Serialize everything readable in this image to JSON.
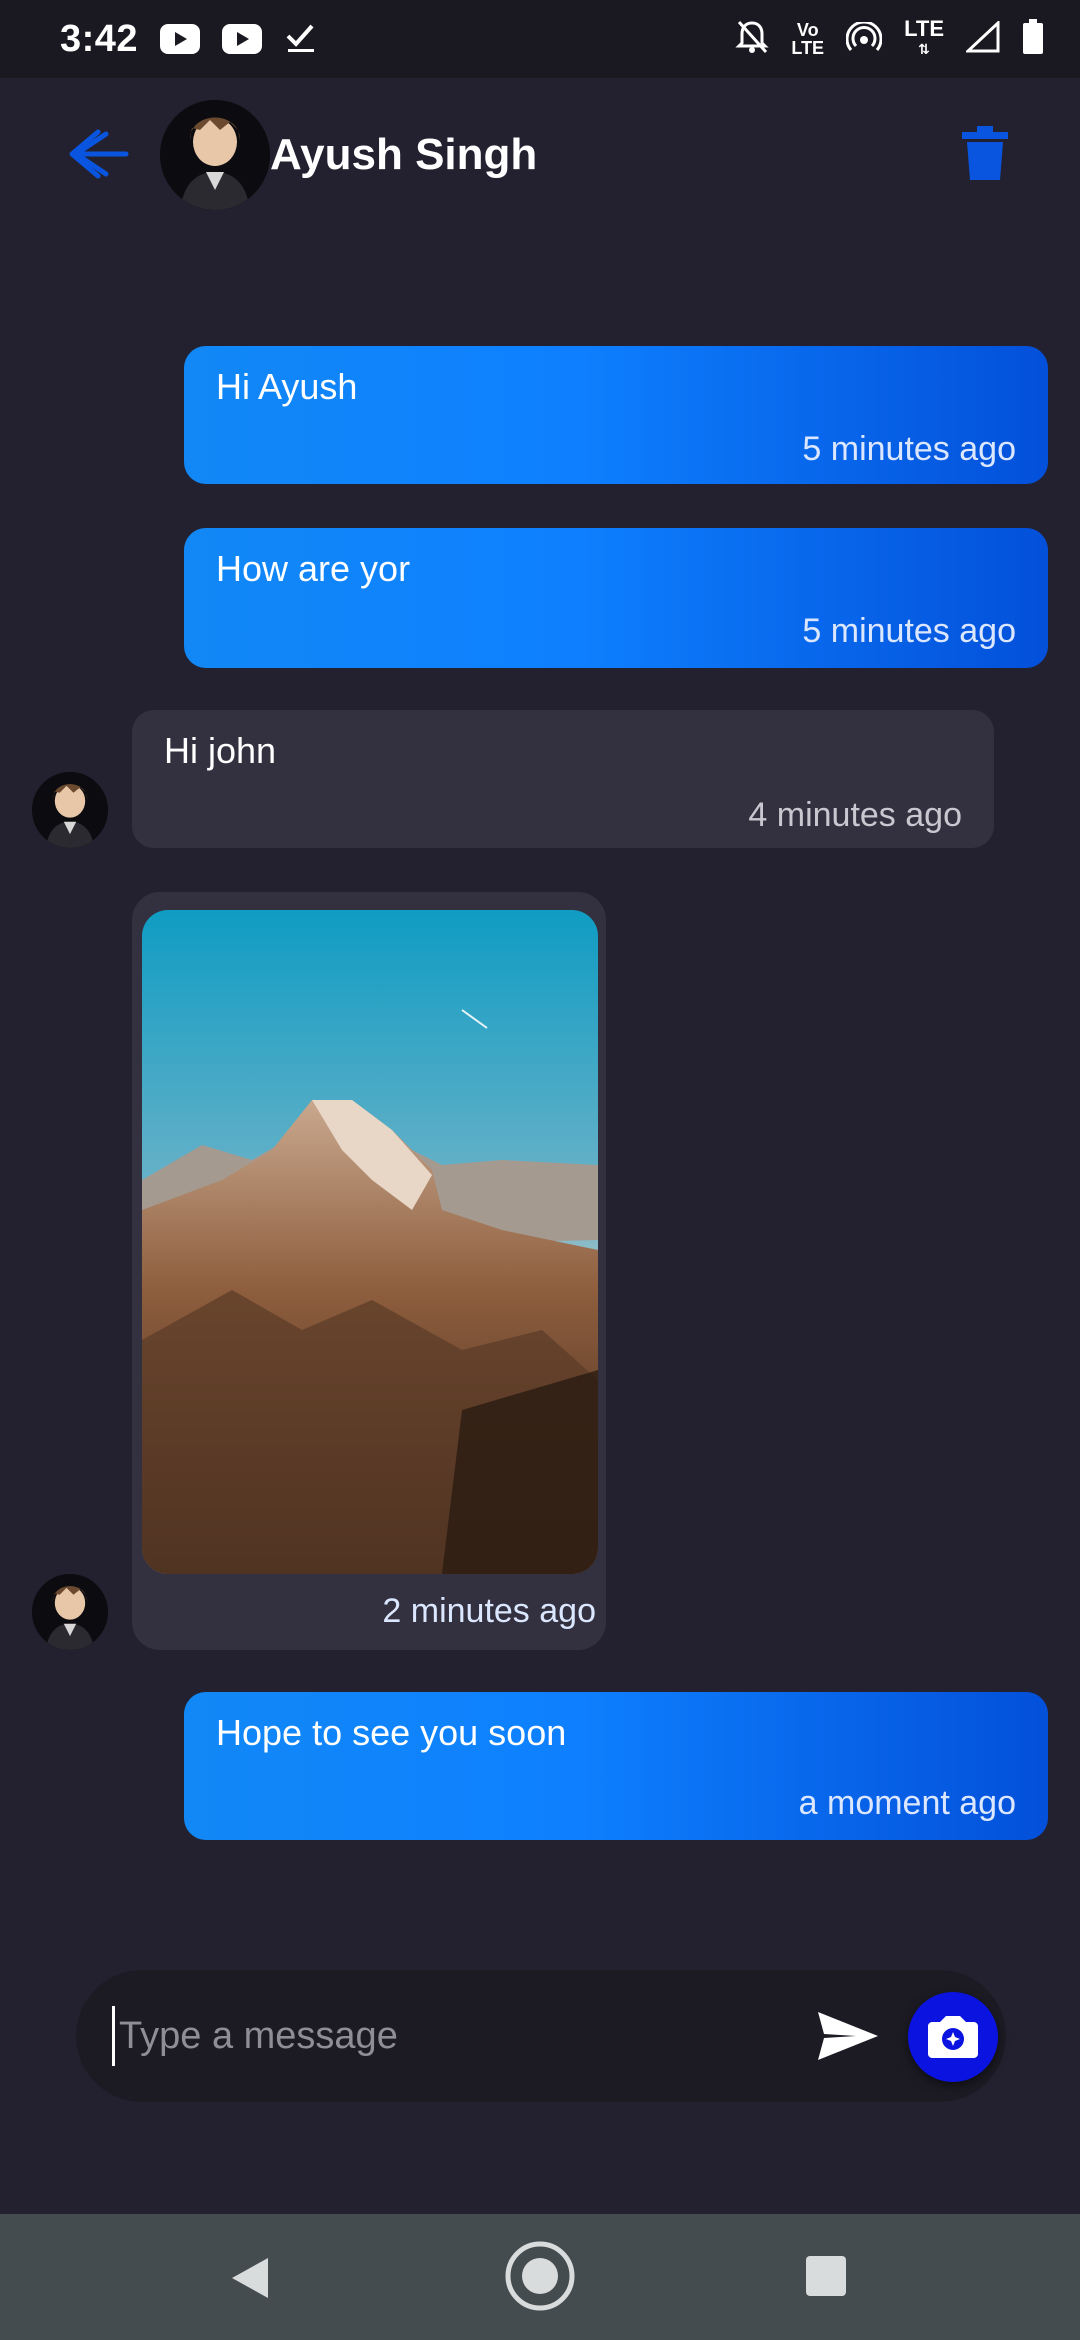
{
  "status_bar": {
    "time": "3:42",
    "volte_label_top": "Vo",
    "volte_label_bottom": "LTE",
    "lte_label": "LTE",
    "icons": [
      "youtube-icon",
      "youtube-icon",
      "check-icon",
      "bell-off-icon",
      "volte-icon",
      "hotspot-icon",
      "lte-icon",
      "signal-icon",
      "battery-icon"
    ]
  },
  "header": {
    "name": "Ayush Singh",
    "accent_color": "#0a55e0"
  },
  "messages": [
    {
      "direction": "outgoing",
      "text": "Hi Ayush",
      "time": "5 minutes ago"
    },
    {
      "direction": "outgoing",
      "text": "How are yor",
      "time": "5 minutes ago"
    },
    {
      "direction": "incoming",
      "text": "Hi john",
      "time": "4 minutes ago"
    },
    {
      "direction": "incoming",
      "type": "image",
      "image_description_icon": "mountain-photo",
      "time": "2 minutes ago"
    },
    {
      "direction": "outgoing",
      "text": "Hope to see you soon",
      "time": "a moment ago"
    }
  ],
  "composer": {
    "placeholder": "Type a message",
    "value": ""
  },
  "colors": {
    "background": "#23212f",
    "incoming_bubble": "#33313f",
    "outgoing_gradient_start": "#1188f6",
    "outgoing_gradient_end": "#0350da",
    "camera_button": "#0b13e0"
  }
}
